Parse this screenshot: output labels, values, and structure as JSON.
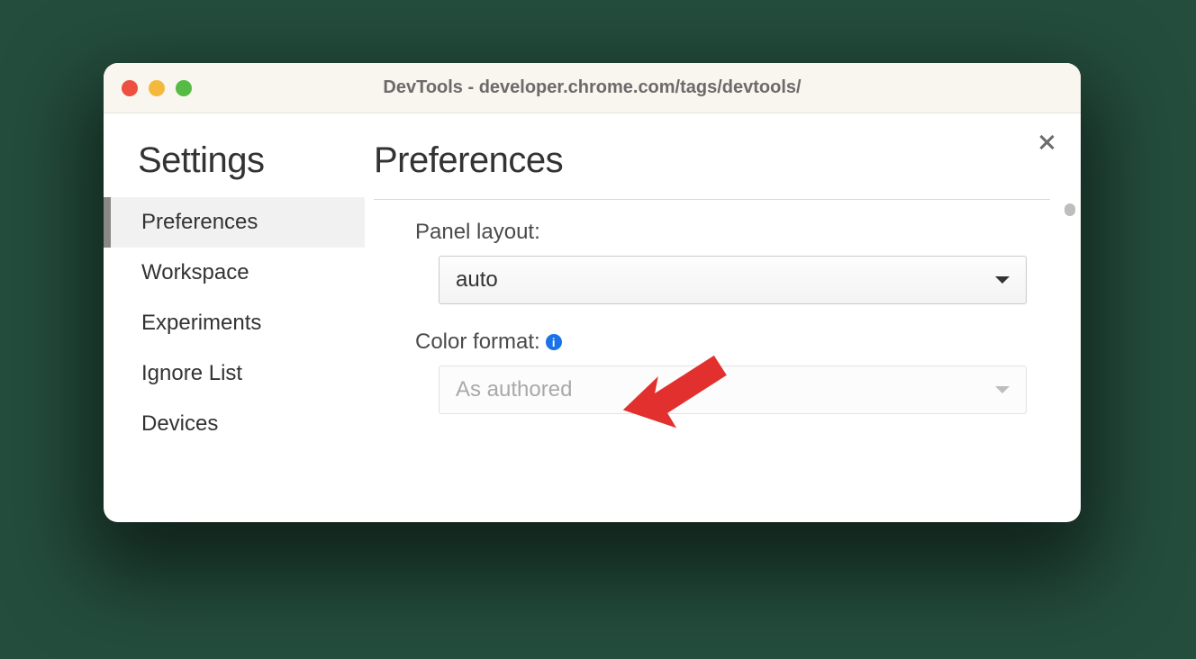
{
  "window": {
    "title": "DevTools - developer.chrome.com/tags/devtools/"
  },
  "sidebar": {
    "heading": "Settings",
    "items": [
      {
        "label": "Preferences",
        "active": true
      },
      {
        "label": "Workspace",
        "active": false
      },
      {
        "label": "Experiments",
        "active": false
      },
      {
        "label": "Ignore List",
        "active": false
      },
      {
        "label": "Devices",
        "active": false
      }
    ]
  },
  "main": {
    "heading": "Preferences",
    "panel_layout": {
      "label": "Panel layout:",
      "value": "auto"
    },
    "color_format": {
      "label": "Color format:",
      "value": "As authored",
      "has_info_icon": true,
      "disabled": true
    }
  },
  "annotation": {
    "arrow_color": "#e2302e"
  }
}
